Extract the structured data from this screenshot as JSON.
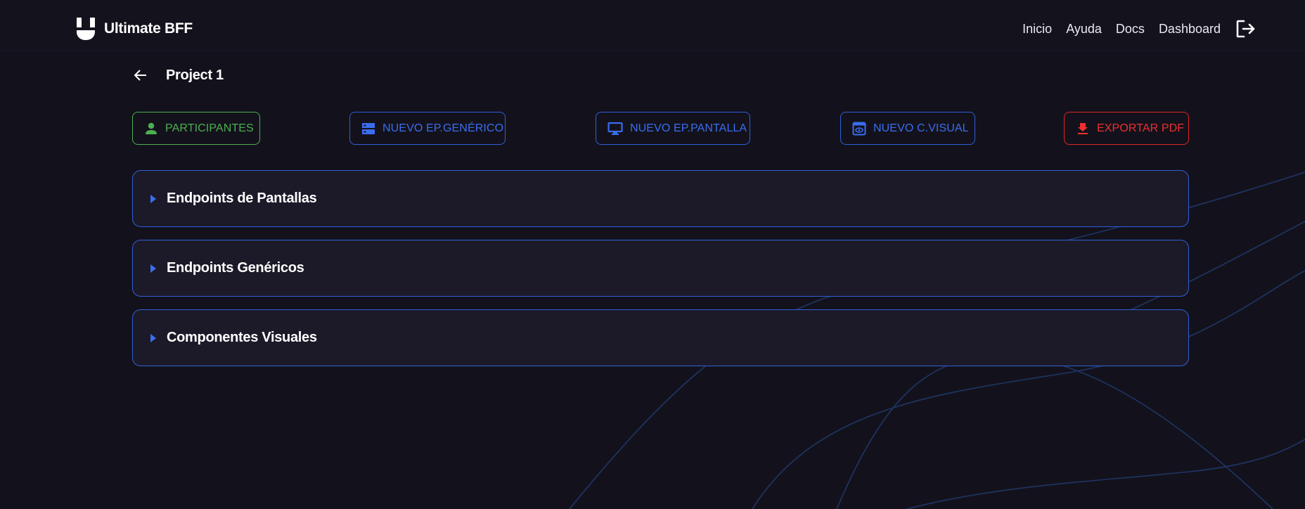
{
  "brand": {
    "name": "Ultimate BFF",
    "logo_icon": "u-logo-icon"
  },
  "nav": {
    "items": [
      "Inicio",
      "Ayuda",
      "Docs",
      "Dashboard"
    ],
    "logout_icon": "logout-icon"
  },
  "project": {
    "title": "Project 1",
    "back_icon": "arrow-left-icon"
  },
  "actions": [
    {
      "label": "PARTICIPANTES",
      "icon": "person-icon",
      "color": "#4caf50"
    },
    {
      "label": "NUEVO EP.GENÉRICO",
      "icon": "storage-icon",
      "color": "#3a6df0"
    },
    {
      "label": "NUEVO EP.PANTALLA",
      "icon": "monitor-icon",
      "color": "#3a6df0"
    },
    {
      "label": "NUEVO C.VISUAL",
      "icon": "visual-icon",
      "color": "#3a6df0"
    },
    {
      "label": "EXPORTAR PDF",
      "icon": "download-icon",
      "color": "#ef2f2f"
    }
  ],
  "sections": [
    {
      "title": "Endpoints de Pantallas",
      "expanded": false
    },
    {
      "title": "Endpoints Genéricos",
      "expanded": false
    },
    {
      "title": "Componentes Visuales",
      "expanded": false
    }
  ],
  "colors": {
    "background": "#13121c",
    "panel": "#1c1a29",
    "accent_blue": "#2f5fd6",
    "success_green": "#4caf50",
    "danger_red": "#e02424"
  }
}
